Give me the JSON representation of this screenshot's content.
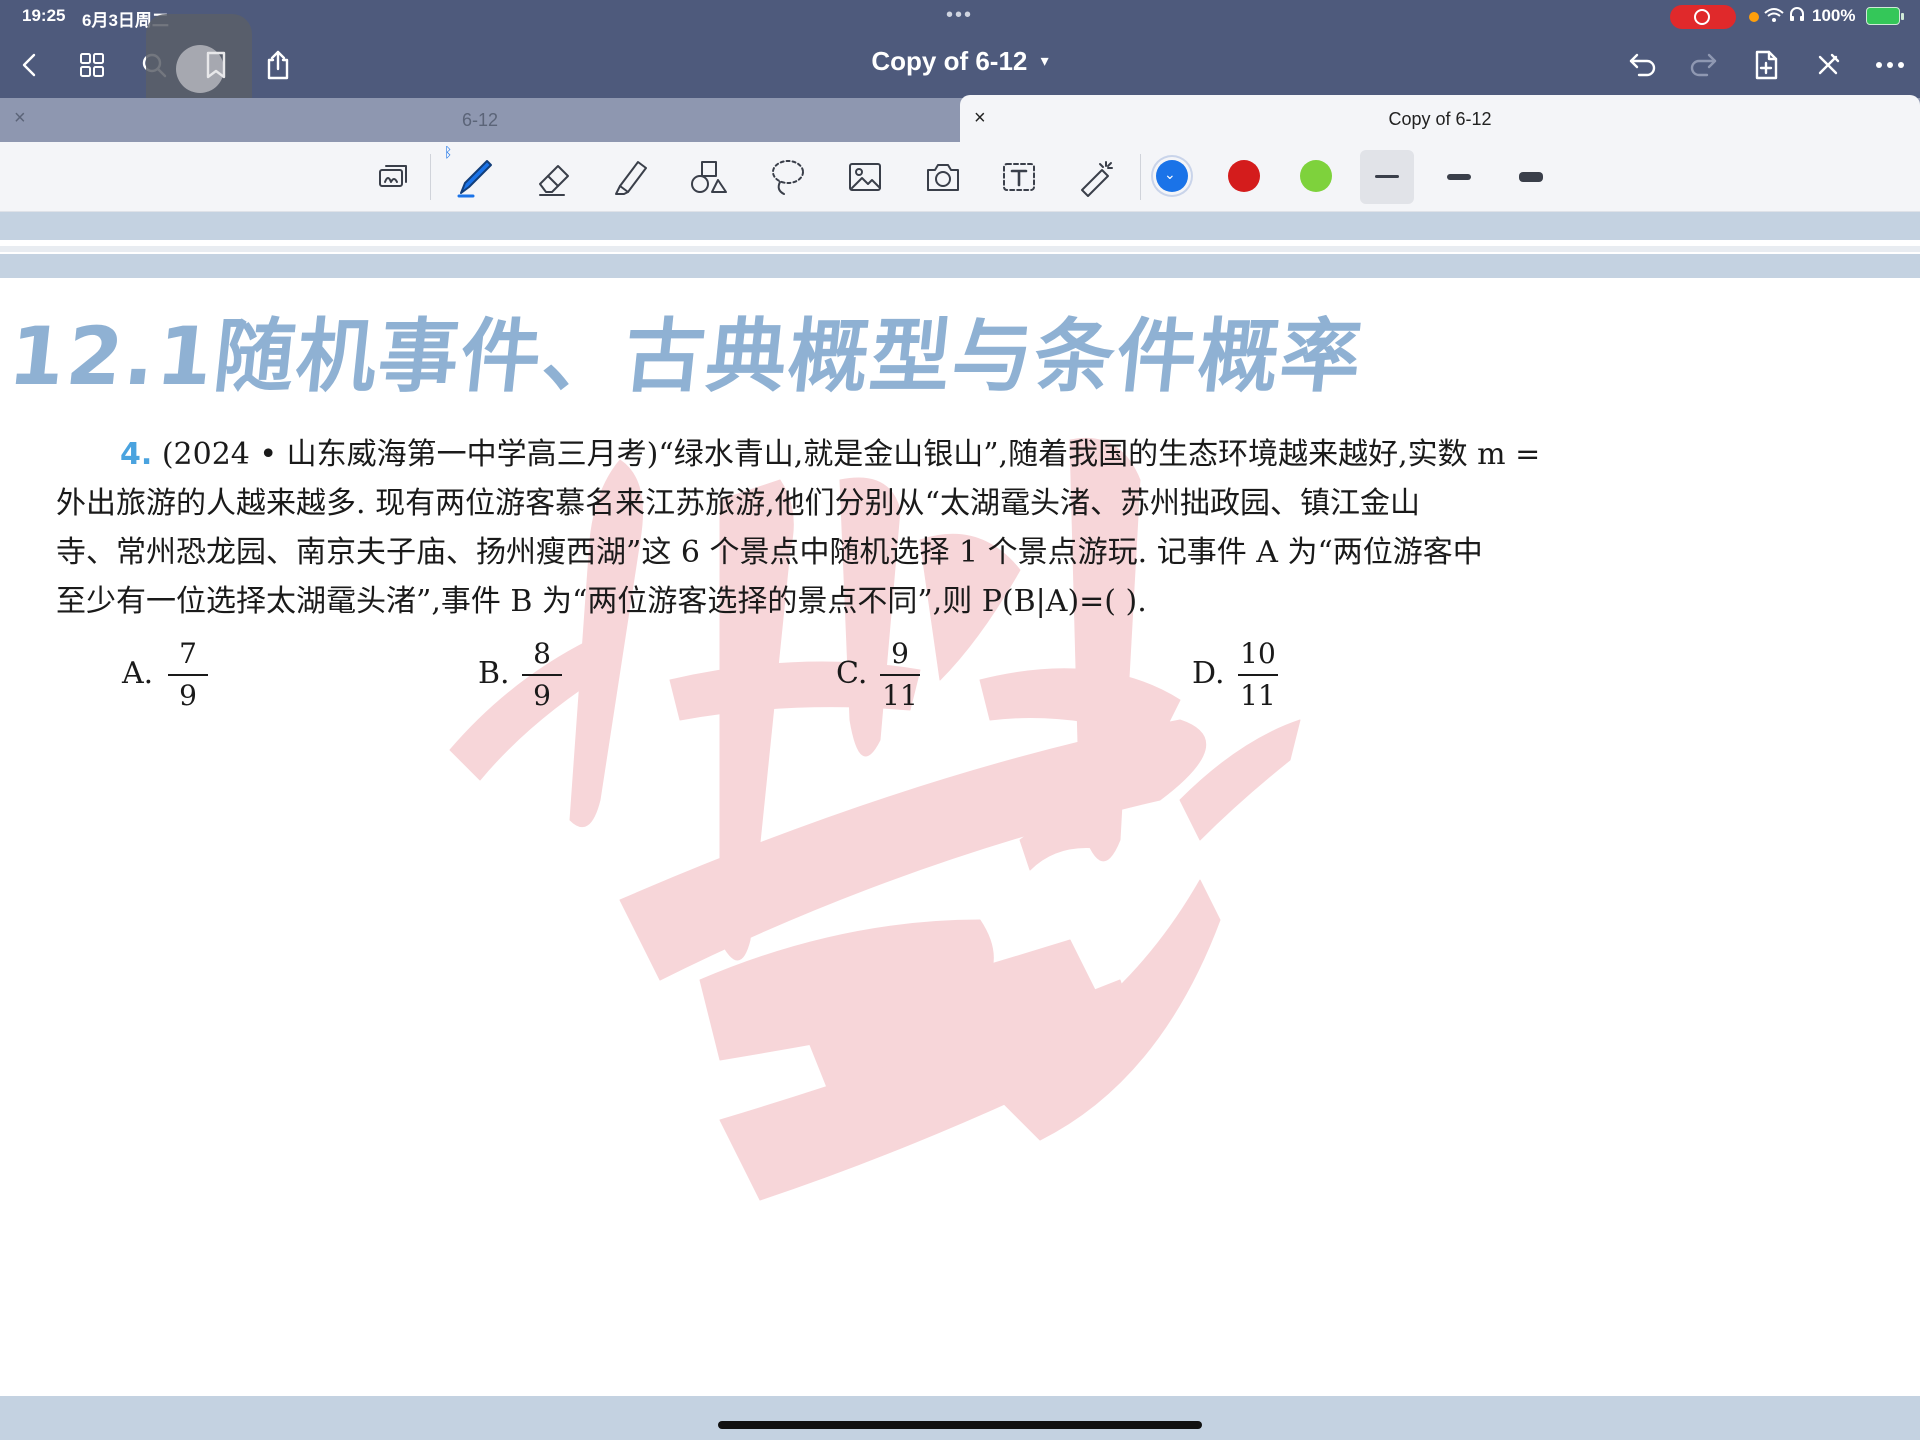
{
  "status_bar": {
    "time": "19:25",
    "date": "6月3日周二",
    "battery": "100%"
  },
  "nav": {
    "title": "Copy of 6-12",
    "title_chevron": "⌄"
  },
  "tabs": [
    {
      "label": "6-12",
      "active": false
    },
    {
      "label": "Copy of 6-12",
      "active": true
    }
  ],
  "toolbar": {
    "tools": [
      "shapes-recognizer-icon",
      "pen-icon",
      "eraser-icon",
      "highlighter-icon",
      "shapes-icon",
      "lasso-icon",
      "image-icon",
      "camera-icon",
      "text-box-icon",
      "laser-pointer-icon"
    ],
    "colors": [
      {
        "name": "blue",
        "hex": "#1a73e8",
        "selected": true
      },
      {
        "name": "red",
        "hex": "#d41c1c",
        "selected": false
      },
      {
        "name": "green",
        "hex": "#7ed23c",
        "selected": false
      }
    ],
    "stroke_widths": [
      "thin",
      "medium",
      "thick"
    ],
    "selected_stroke": "thin"
  },
  "document": {
    "heading": "12.1随机事件、古典概型与条件概率",
    "question": {
      "number": "4.",
      "lines": [
        "(2024 • 山东威海第一中学高三月考)“绿水青山,就是金山银山”,随着我国的生态环境越来越好,实数 m =",
        "外出旅游的人越来越多. 现有两位游客慕名来江苏旅游,他们分别从“太湖鼋头渚、苏州拙政园、镇江金山",
        "寺、常州恐龙园、南京夫子庙、扬州瘦西湖”这 6 个景点中随机选择 1 个景点游玩. 记事件 A 为“两位游客中",
        "至少有一位选择太湖鼋头渚”,事件 B 为“两位游客选择的景点不同”,则 P(B|A)=(      )."
      ]
    },
    "options": [
      {
        "letter": "A.",
        "numerator": "7",
        "denominator": "9"
      },
      {
        "letter": "B.",
        "numerator": "8",
        "denominator": "9"
      },
      {
        "letter": "C.",
        "numerator": "9",
        "denominator": "11"
      },
      {
        "letter": "D.",
        "numerator": "10",
        "denominator": "11"
      }
    ]
  },
  "colors": {
    "nav_bg": "#4e5a7c",
    "heading": "#8fb1d3",
    "watermark": "#f6cfd3",
    "question_number": "#4aa3df"
  }
}
